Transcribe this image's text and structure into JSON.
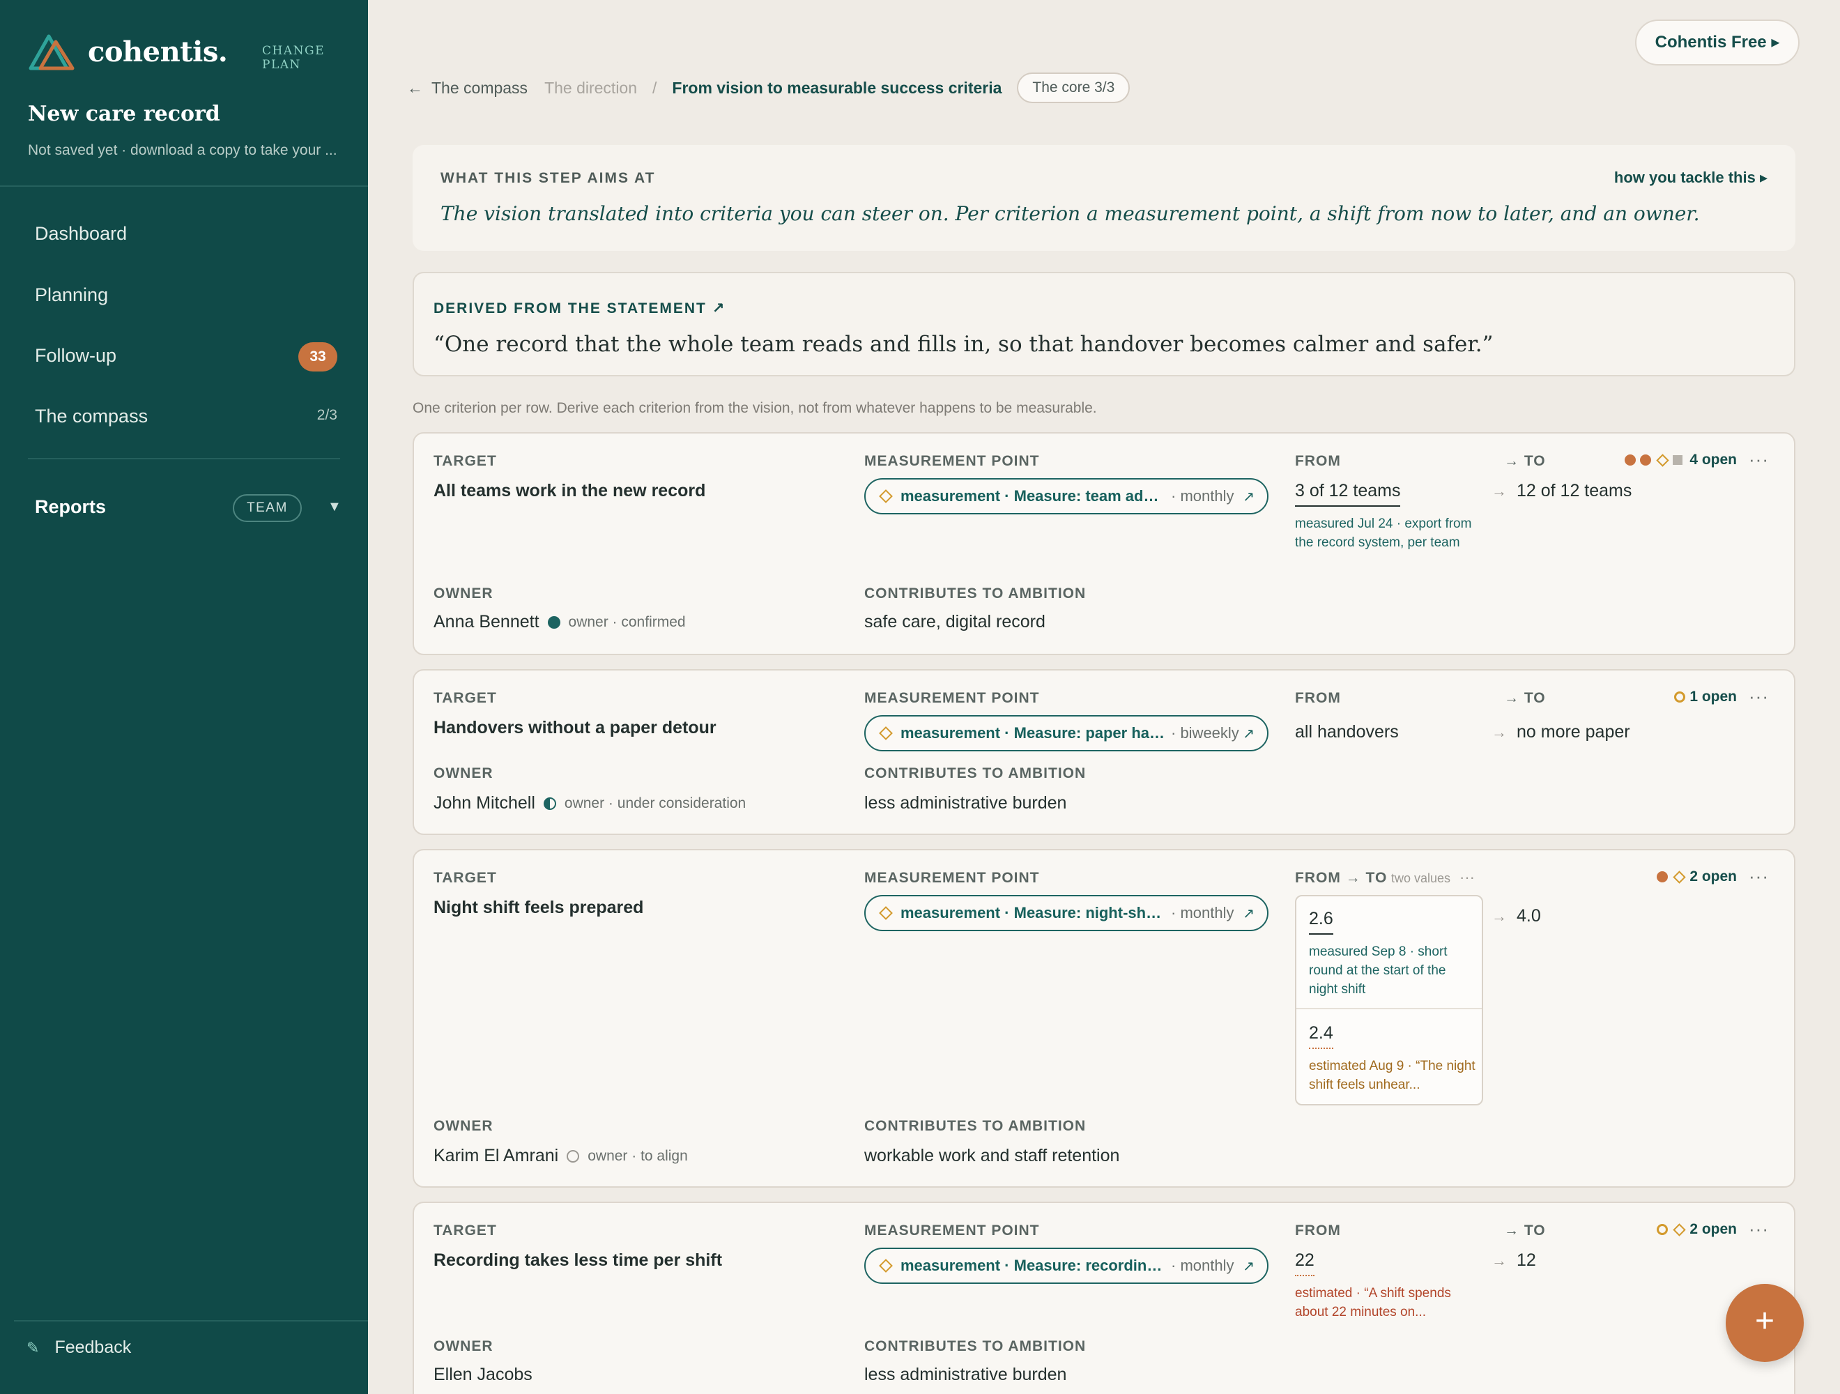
{
  "brand": {
    "name": "cohentis.",
    "change_plan": "CHANGE PLAN"
  },
  "record": {
    "title": "New care record",
    "subtitle": "Not saved yet · download a copy to take your ..."
  },
  "nav": {
    "dashboard": "Dashboard",
    "planning": "Planning",
    "followup": "Follow-up",
    "followup_badge": "33",
    "compass": "The compass",
    "compass_count": "2/3",
    "reports": "Reports",
    "team_pill": "TEAM",
    "caret": "▼"
  },
  "feedback": "Feedback",
  "header": {
    "plan_button": "Cohentis Free ▸"
  },
  "breadcrumb": {
    "back": "The compass",
    "direction": "The direction",
    "separator": "/",
    "current": "From vision to measurable success criteria",
    "core": "The core 3/3"
  },
  "aims": {
    "label": "WHAT THIS STEP AIMS AT",
    "link": "how you tackle this ▸",
    "text": "The vision translated into criteria you can steer on. Per criterion a measurement point, a shift from now to later, and an owner."
  },
  "statement": {
    "label": "DERIVED FROM THE STATEMENT ↗",
    "text": "“One record that the whole team reads and fills in, so that handover becomes calmer and safer.”"
  },
  "hint": "One criterion per row. Derive each criterion from the vision, not from whatever happens to be measurable.",
  "labels": {
    "target": "TARGET",
    "measurement": "MEASUREMENT POINT",
    "from": "FROM",
    "to": "→ TO",
    "from_to": "FROM → TO",
    "two_values": "two values",
    "owner": "OWNER",
    "ambition": "CONTRIBUTES TO AMBITION",
    "arrow": "→",
    "more": "···",
    "ext": "↗"
  },
  "criteria": [
    {
      "target": "All teams work in the new record",
      "measure": "measurement · Measure: team adoption of the new record",
      "freq": "· monthly",
      "from": "3 of 12 teams",
      "from_note": "measured Jul 24 · export from the record system, per team",
      "to": "12 of 12 teams",
      "status": "4 open",
      "owner": "Anna Bennett",
      "owner_status": "owner · confirmed",
      "ambition": "safe care, digital record"
    },
    {
      "target": "Handovers without a paper detour",
      "measure": "measurement · Measure: paper handovers",
      "freq": "· biweekly",
      "from": "all handovers",
      "to": "no more paper",
      "status": "1 open",
      "owner": "John Mitchell",
      "owner_status": "owner · under consideration",
      "ambition": "less administrative burden"
    },
    {
      "target": "Night shift feels prepared",
      "measure": "measurement · Measure: night-shift preparedness",
      "freq": "· monthly",
      "from1": "2.6",
      "from1_note": "measured Sep 8 · short round at the start of the night shift",
      "from2": "2.4",
      "from2_note": "estimated Aug 9 · “The night shift feels unhear...",
      "to": "4.0",
      "status": "2 open",
      "owner": "Karim El Amrani",
      "owner_status": "owner · to align",
      "ambition": "workable work and staff retention"
    },
    {
      "target": "Recording takes less time per shift",
      "measure": "measurement · Measure: recording time per shift",
      "freq": "· monthly",
      "from": "22",
      "from_note": "estimated · “A shift spends about 22 minutes on...",
      "to": "12",
      "status": "2 open",
      "owner": "Ellen Jacobs",
      "ambition": "less administrative burden"
    }
  ],
  "fab": "+",
  "colors": {
    "sidebar": "#104a48",
    "accent": "#c8733f",
    "teal": "#154d4a",
    "amber": "#d39a2c"
  },
  "icons": [
    "logo-icon",
    "back-arrow-icon",
    "pencil-icon",
    "diamond-icon",
    "external-link-icon",
    "more-icon",
    "plus-icon"
  ]
}
